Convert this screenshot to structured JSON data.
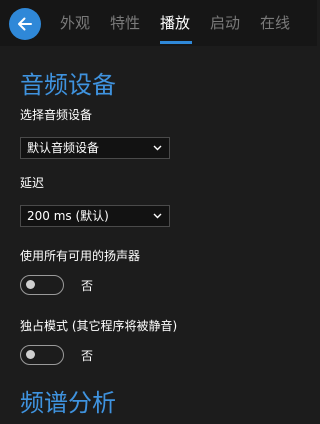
{
  "tabs": [
    {
      "label": "外观"
    },
    {
      "label": "特性"
    },
    {
      "label": "播放"
    },
    {
      "label": "启动"
    },
    {
      "label": "在线"
    }
  ],
  "active_tab": "播放",
  "colors": {
    "accent": "#2f88d8",
    "heading": "#3f93df",
    "background": "#1c1c1c"
  },
  "audio_device": {
    "heading": "音频设备",
    "device_label": "选择音频设备",
    "device_value": "默认音频设备",
    "latency_label": "延迟",
    "latency_value": "200 ms (默认)",
    "all_speakers_label": "使用所有可用的扬声器",
    "all_speakers_state": "否",
    "exclusive_label": "独占模式 (其它程序将被静音)",
    "exclusive_state": "否"
  },
  "spectrum": {
    "heading": "频谱分析"
  },
  "icons": {
    "back": "arrow-left-icon",
    "dropdown": "chevron-down-icon"
  }
}
